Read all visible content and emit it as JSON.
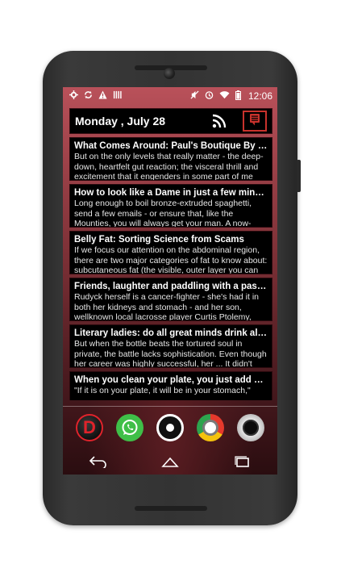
{
  "status_bar": {
    "time": "12:06",
    "left_icons": [
      "settings-gear-icon",
      "sync-icon",
      "warning-icon",
      "storage-icon"
    ],
    "right_icons": [
      "mute-icon",
      "alarm-icon",
      "wifi-icon",
      "battery-icon"
    ]
  },
  "header": {
    "date": "Monday , July 28",
    "icons": [
      "rss-icon",
      "list-menu-icon"
    ]
  },
  "feed": {
    "items": [
      {
        "title": "What Comes Around: Paul's Boutique By The..",
        "body": "But on the only levels that really matter - the deep-down, heartfelt gut reaction; the visceral thrill and excitement that it engenders in some part of me"
      },
      {
        "title": "How to look like a Dame in just a few minutes",
        "body": "Long enough to boil bronze-extruded spaghetti, send a few emails - or ensure that, like the Mounties, you will always get your man. A now-"
      },
      {
        "title": "Belly Fat: Sorting Science from Scams",
        "body": "If we focus our attention on the abdominal region, there are two major categories of fat to know about: subcutaneous fat (the visible, outer layer you can"
      },
      {
        "title": "Friends, laughter and paddling with a passion",
        "body": "Rudyck herself is a cancer-fighter - she's had it in both her kidneys and stomach - and her son, wellknown local lacrosse player Curtis Ptolemy,"
      },
      {
        "title": "Literary ladies: do all great minds drink alike?",
        "body": "But when the bottle beats the tortured soul in private, the battle lacks sophistication. Even though her career was highly successful, her ... It didn't"
      },
      {
        "title": "When you clean your plate, you just add weight",
        "body": "\"If it is on your plate, it will be in your stomach,\" says"
      }
    ]
  },
  "dock": {
    "apps": [
      {
        "name": "d-app-icon",
        "glyph": "D"
      },
      {
        "name": "whatsapp-icon"
      },
      {
        "name": "record-dot-icon"
      },
      {
        "name": "chrome-icon"
      },
      {
        "name": "camera-icon"
      }
    ]
  },
  "nav": [
    "back-icon",
    "home-icon",
    "recents-icon"
  ],
  "colors": {
    "accent_red": "#c8322c",
    "card_bg": "#000000",
    "whatsapp_green": "#3fbf48"
  }
}
